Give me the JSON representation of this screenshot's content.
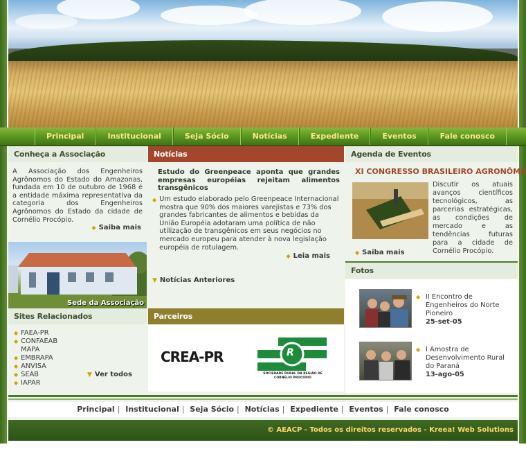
{
  "nav": {
    "items": [
      "Principal",
      "Institucional",
      "Seja Sócio",
      "Notícias",
      "Expediente",
      "Eventos",
      "Fale conosco"
    ]
  },
  "about": {
    "title": "Conheça a Associação",
    "text": "A Associação dos Engenheiros Agrônomos do Estado do Amazonas, fundada em 10 de outubro de 1968 é a entidade máxima representativa da categoria dos Engenheiros Agrônomos do Estado da cidade de Cornélio Procópio.",
    "more": "Saiba mais",
    "photo_caption": "Sede da Associação"
  },
  "sites": {
    "title": "Sites Relacionados",
    "items": [
      "FAEA-PR",
      "CONFAEAB",
      "MAPA",
      "EMBRAPA",
      "ANVISA",
      "SEAB",
      "IAPAR"
    ],
    "all": "Ver todos"
  },
  "news": {
    "title": "Notícias",
    "headline": "Estudo do Greenpeace aponta que grandes empresas européias rejeitam alimentos transgênicos",
    "body": "Um estudo elaborado pelo Greenpeace Internacional mostra que 90% dos maiores varejistas e 73% dos grandes fabricantes de alimentos e bebidas da União Européia adotaram uma política de não utilização de transgênicos em seus negócios no mercado europeu para atender à nova legislação européia de rotulagem.",
    "more": "Leia mais",
    "previous": "Notícias Anteriores"
  },
  "partners": {
    "title": "Parceiros",
    "crea": "CREA-PR",
    "srlogo_letter": "R",
    "srlogo_text": "SOCIEDADE RURAL DA REGIÃO DE CORNÉLIO PROCÓPIO"
  },
  "events": {
    "title": "Agenda de Eventos",
    "event_title": "XI CONGRESSO BRASILEIRO AGRONÔMICO",
    "event_text": "Discutir os atuais avanços científicos tecnológicos, as parcerias estratégicas, as condições de mercado e as tendências futuras para a cidade de Cornélio Procópio.",
    "more": "Saiba mais"
  },
  "photos": {
    "title": "Fotos",
    "items": [
      {
        "caption": "II Encontro de Engenheiros do Norte Pioneiro",
        "date": "25-set-05"
      },
      {
        "caption": "I Amostra de Desenvolvimento Rural do Paraná",
        "date": "13-ago-05"
      }
    ]
  },
  "footer": {
    "links": [
      "Principal",
      "Institucional",
      "Seja Sócio",
      "Notícias",
      "Expediente",
      "Eventos",
      "Fale conosco"
    ],
    "copyright": "© AEACP - Todos os direitos reservados - Kreea! Web Solutions"
  },
  "colors": {
    "nav_green": "#5f9b23",
    "nav_text": "#ffe68a",
    "news_head": "#a3472c",
    "partners_head": "#8f7e2c",
    "event_title": "#a3472c",
    "bullet": "#d3a200"
  }
}
